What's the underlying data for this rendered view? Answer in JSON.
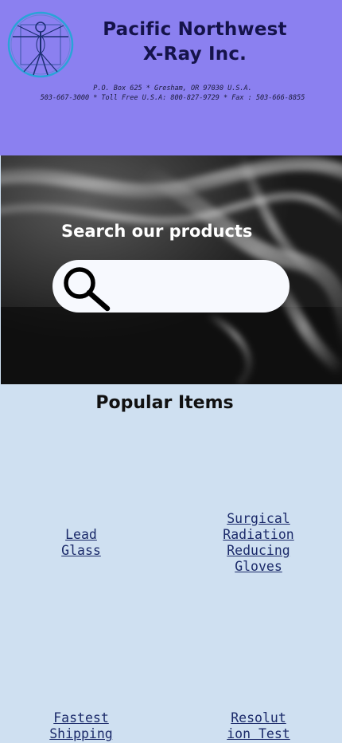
{
  "header": {
    "logo": "vitruvian-man-logo",
    "company_line1": "Pacific Northwest",
    "company_line2": "X-Ray Inc.",
    "address_line1": "P.O. Box 625 * Gresham, OR 97030 U.S.A.",
    "address_line2": "503-667-3000 * Toll Free U.S.A: 800-827-9729 * Fax : 503-666-8855"
  },
  "hero": {
    "title": "Search our products",
    "search_icon": "magnifying-glass-icon",
    "search_value": "",
    "search_placeholder": ""
  },
  "popular": {
    "title": "Popular Items",
    "items": [
      {
        "lines": [
          "Lead",
          "Glass"
        ]
      },
      {
        "lines": [
          "Surgical",
          "Radiation",
          "Reducing",
          "Gloves"
        ]
      },
      {
        "lines": [
          "Fastest",
          "Shipping"
        ]
      },
      {
        "lines": [
          "Resolut",
          "ion Test"
        ]
      }
    ]
  },
  "colors": {
    "header_bg": "#8b80f0",
    "page_bg": "#cfe0f1",
    "link": "#1b2a6a"
  }
}
